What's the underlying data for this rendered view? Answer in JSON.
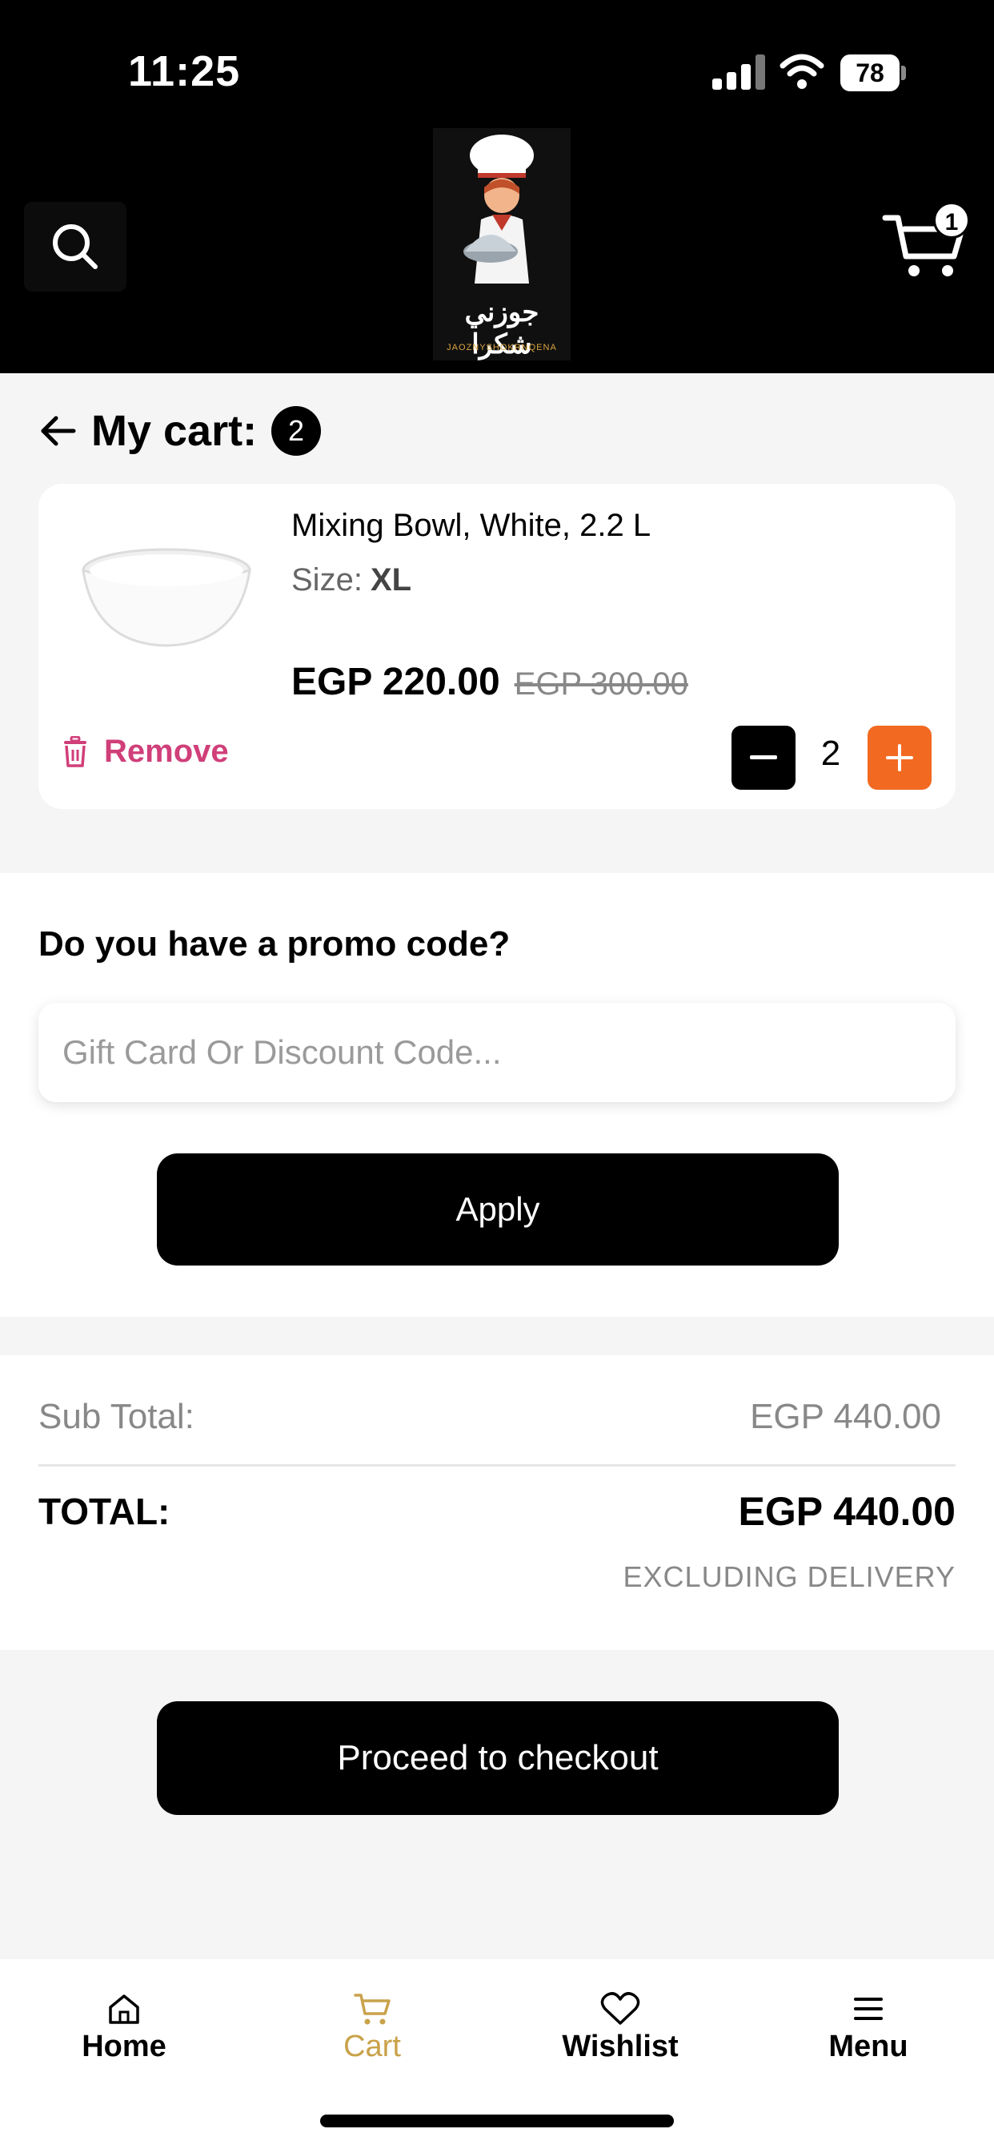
{
  "status_bar": {
    "time": "11:25",
    "battery": "78"
  },
  "header": {
    "logo_arabic": "جوزني شكرا",
    "logo_sub": "JAOZNYSHOKRNQENA",
    "cart_count": "1"
  },
  "cart": {
    "title": "My cart:",
    "item_count": "2",
    "items": [
      {
        "name": "Mixing Bowl, White, 2.2 L",
        "size_label": "Size:",
        "size_value": "XL",
        "price": "EGP 220.00",
        "old_price": "EGP 300.00",
        "remove_label": "Remove",
        "quantity": "2"
      }
    ]
  },
  "promo": {
    "title": "Do you have a promo code?",
    "placeholder": "Gift Card Or Discount Code...",
    "apply_label": "Apply"
  },
  "totals": {
    "sub_total_label": "Sub Total:",
    "sub_total_value": "EGP 440.00",
    "total_label": "TOTAL:",
    "total_value": "EGP 440.00",
    "note": "EXCLUDING DELIVERY"
  },
  "checkout": {
    "label": "Proceed to checkout"
  },
  "bottom_nav": {
    "items": [
      {
        "label": "Home",
        "icon": "home-icon"
      },
      {
        "label": "Cart",
        "icon": "cart-icon",
        "active": true
      },
      {
        "label": "Wishlist",
        "icon": "heart-icon"
      },
      {
        "label": "Menu",
        "icon": "menu-icon"
      }
    ]
  },
  "colors": {
    "accent_orange": "#f26a21",
    "remove_pink": "#d03f79",
    "active_nav": "#c9a24a"
  }
}
